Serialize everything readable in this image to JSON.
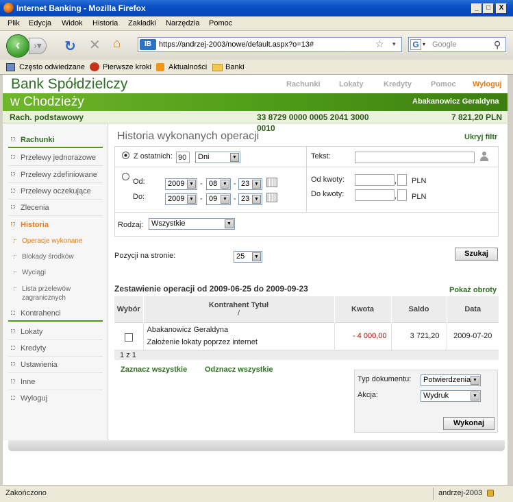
{
  "window": {
    "title": "Internet Banking - Mozilla Firefox",
    "min": "_",
    "max": "□",
    "close": "X"
  },
  "menu": [
    "Plik",
    "Edycja",
    "Widok",
    "Historia",
    "Zakładki",
    "Narzędzia",
    "Pomoc"
  ],
  "nav": {
    "url": "https://andrzej-2003/nowe/default.aspx?o=13#",
    "search_placeholder": "Google",
    "site_badge": "IB"
  },
  "bookmarks": [
    "Często odwiedzane",
    "Pierwsze kroki",
    "Aktualności",
    "Banki"
  ],
  "bank": {
    "name_line1": "Bank Spółdzielczy",
    "name_line2": "w Chodzieży",
    "user": "Abakanowicz Geraldyna"
  },
  "topnav": [
    "Rachunki",
    "Lokaty",
    "Kredyty",
    "Pomoc",
    "Wyloguj"
  ],
  "account": {
    "label": "Rach. podstawowy",
    "number_line1": "33 8729 0000 0005 2041 3000",
    "number_line2": "0010",
    "balance": "7 821,20 PLN"
  },
  "sidebar": {
    "items": [
      "Rachunki",
      "Przelewy jednorazowe",
      "Przelewy zdefiniowane",
      "Przelewy oczekujące",
      "Zlecenia",
      "Historia"
    ],
    "sub": [
      "Operacje wykonane",
      "Blokady środków",
      "Wyciągi",
      "Lista przelewów",
      "zagranicznych"
    ],
    "items2": [
      "Kontrahenci",
      "Lokaty",
      "Kredyty",
      "Ustawienia",
      "Inne",
      "Wyloguj"
    ]
  },
  "main": {
    "title": "Historia wykonanych operacji",
    "hide_filter": "Ukryj filtr",
    "last_label": "Z ostatnich:",
    "last_value": "90",
    "last_unit": "Dni",
    "from_label": "Od:",
    "to_label": "Do:",
    "from": {
      "y": "2009",
      "m": "08",
      "d": "23"
    },
    "to": {
      "y": "2009",
      "m": "09",
      "d": "23"
    },
    "dash": "-",
    "text_label": "Tekst:",
    "amount_from": "Od kwoty:",
    "amount_to": "Do kwoty:",
    "decimal_sep": ",",
    "currency": "PLN",
    "type_label": "Rodzaj:",
    "type_value": "Wszystkie",
    "per_page_label": "Pozycji na stronie:",
    "per_page_value": "25",
    "search_btn": "Szukaj",
    "summary": "Zestawienie operacji od 2009-06-25 do 2009-09-23",
    "show_turnover": "Pokaż obroty",
    "columns": {
      "select": "Wybór",
      "party": "Kontrahent Tytuł",
      "party2": "/",
      "amount": "Kwota",
      "balance": "Saldo",
      "date": "Data"
    },
    "rows": [
      {
        "party": "Abakanowicz Geraldyna",
        "title": "Założenie lokaty poprzez internet",
        "amount": "- 4 000,00",
        "balance": "3 721,20",
        "date": "2009-07-20"
      }
    ],
    "pager": "1 z 1",
    "select_all": "Zaznacz wszystkie",
    "deselect_all": "Odznacz wszystkie",
    "doc_type_label": "Typ dokumentu:",
    "doc_type_value": "Potwierdzenia",
    "action_label": "Akcja:",
    "action_value": "Wydruk",
    "execute_btn": "Wykonaj"
  },
  "status": {
    "text": "Zakończono",
    "host": "andrzej-2003"
  },
  "colors": {
    "brand_green": "#4e9a18",
    "active_orange": "#e87b14",
    "negative_red": "#c00000"
  }
}
